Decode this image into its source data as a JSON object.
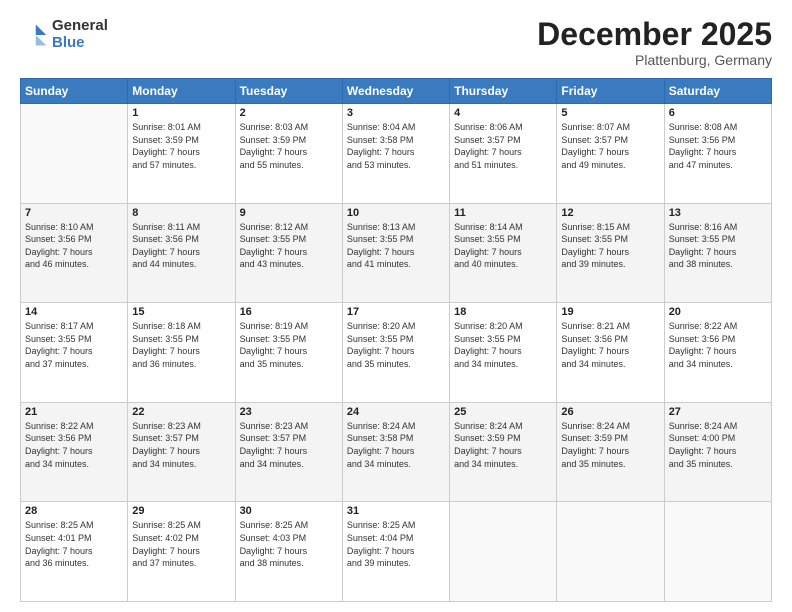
{
  "logo": {
    "general": "General",
    "blue": "Blue"
  },
  "header": {
    "month": "December 2025",
    "location": "Plattenburg, Germany"
  },
  "weekdays": [
    "Sunday",
    "Monday",
    "Tuesday",
    "Wednesday",
    "Thursday",
    "Friday",
    "Saturday"
  ],
  "weeks": [
    [
      {
        "day": "",
        "info": ""
      },
      {
        "day": "1",
        "info": "Sunrise: 8:01 AM\nSunset: 3:59 PM\nDaylight: 7 hours\nand 57 minutes."
      },
      {
        "day": "2",
        "info": "Sunrise: 8:03 AM\nSunset: 3:59 PM\nDaylight: 7 hours\nand 55 minutes."
      },
      {
        "day": "3",
        "info": "Sunrise: 8:04 AM\nSunset: 3:58 PM\nDaylight: 7 hours\nand 53 minutes."
      },
      {
        "day": "4",
        "info": "Sunrise: 8:06 AM\nSunset: 3:57 PM\nDaylight: 7 hours\nand 51 minutes."
      },
      {
        "day": "5",
        "info": "Sunrise: 8:07 AM\nSunset: 3:57 PM\nDaylight: 7 hours\nand 49 minutes."
      },
      {
        "day": "6",
        "info": "Sunrise: 8:08 AM\nSunset: 3:56 PM\nDaylight: 7 hours\nand 47 minutes."
      }
    ],
    [
      {
        "day": "7",
        "info": "Sunrise: 8:10 AM\nSunset: 3:56 PM\nDaylight: 7 hours\nand 46 minutes."
      },
      {
        "day": "8",
        "info": "Sunrise: 8:11 AM\nSunset: 3:56 PM\nDaylight: 7 hours\nand 44 minutes."
      },
      {
        "day": "9",
        "info": "Sunrise: 8:12 AM\nSunset: 3:55 PM\nDaylight: 7 hours\nand 43 minutes."
      },
      {
        "day": "10",
        "info": "Sunrise: 8:13 AM\nSunset: 3:55 PM\nDaylight: 7 hours\nand 41 minutes."
      },
      {
        "day": "11",
        "info": "Sunrise: 8:14 AM\nSunset: 3:55 PM\nDaylight: 7 hours\nand 40 minutes."
      },
      {
        "day": "12",
        "info": "Sunrise: 8:15 AM\nSunset: 3:55 PM\nDaylight: 7 hours\nand 39 minutes."
      },
      {
        "day": "13",
        "info": "Sunrise: 8:16 AM\nSunset: 3:55 PM\nDaylight: 7 hours\nand 38 minutes."
      }
    ],
    [
      {
        "day": "14",
        "info": "Sunrise: 8:17 AM\nSunset: 3:55 PM\nDaylight: 7 hours\nand 37 minutes."
      },
      {
        "day": "15",
        "info": "Sunrise: 8:18 AM\nSunset: 3:55 PM\nDaylight: 7 hours\nand 36 minutes."
      },
      {
        "day": "16",
        "info": "Sunrise: 8:19 AM\nSunset: 3:55 PM\nDaylight: 7 hours\nand 35 minutes."
      },
      {
        "day": "17",
        "info": "Sunrise: 8:20 AM\nSunset: 3:55 PM\nDaylight: 7 hours\nand 35 minutes."
      },
      {
        "day": "18",
        "info": "Sunrise: 8:20 AM\nSunset: 3:55 PM\nDaylight: 7 hours\nand 34 minutes."
      },
      {
        "day": "19",
        "info": "Sunrise: 8:21 AM\nSunset: 3:56 PM\nDaylight: 7 hours\nand 34 minutes."
      },
      {
        "day": "20",
        "info": "Sunrise: 8:22 AM\nSunset: 3:56 PM\nDaylight: 7 hours\nand 34 minutes."
      }
    ],
    [
      {
        "day": "21",
        "info": "Sunrise: 8:22 AM\nSunset: 3:56 PM\nDaylight: 7 hours\nand 34 minutes."
      },
      {
        "day": "22",
        "info": "Sunrise: 8:23 AM\nSunset: 3:57 PM\nDaylight: 7 hours\nand 34 minutes."
      },
      {
        "day": "23",
        "info": "Sunrise: 8:23 AM\nSunset: 3:57 PM\nDaylight: 7 hours\nand 34 minutes."
      },
      {
        "day": "24",
        "info": "Sunrise: 8:24 AM\nSunset: 3:58 PM\nDaylight: 7 hours\nand 34 minutes."
      },
      {
        "day": "25",
        "info": "Sunrise: 8:24 AM\nSunset: 3:59 PM\nDaylight: 7 hours\nand 34 minutes."
      },
      {
        "day": "26",
        "info": "Sunrise: 8:24 AM\nSunset: 3:59 PM\nDaylight: 7 hours\nand 35 minutes."
      },
      {
        "day": "27",
        "info": "Sunrise: 8:24 AM\nSunset: 4:00 PM\nDaylight: 7 hours\nand 35 minutes."
      }
    ],
    [
      {
        "day": "28",
        "info": "Sunrise: 8:25 AM\nSunset: 4:01 PM\nDaylight: 7 hours\nand 36 minutes."
      },
      {
        "day": "29",
        "info": "Sunrise: 8:25 AM\nSunset: 4:02 PM\nDaylight: 7 hours\nand 37 minutes."
      },
      {
        "day": "30",
        "info": "Sunrise: 8:25 AM\nSunset: 4:03 PM\nDaylight: 7 hours\nand 38 minutes."
      },
      {
        "day": "31",
        "info": "Sunrise: 8:25 AM\nSunset: 4:04 PM\nDaylight: 7 hours\nand 39 minutes."
      },
      {
        "day": "",
        "info": ""
      },
      {
        "day": "",
        "info": ""
      },
      {
        "day": "",
        "info": ""
      }
    ]
  ]
}
